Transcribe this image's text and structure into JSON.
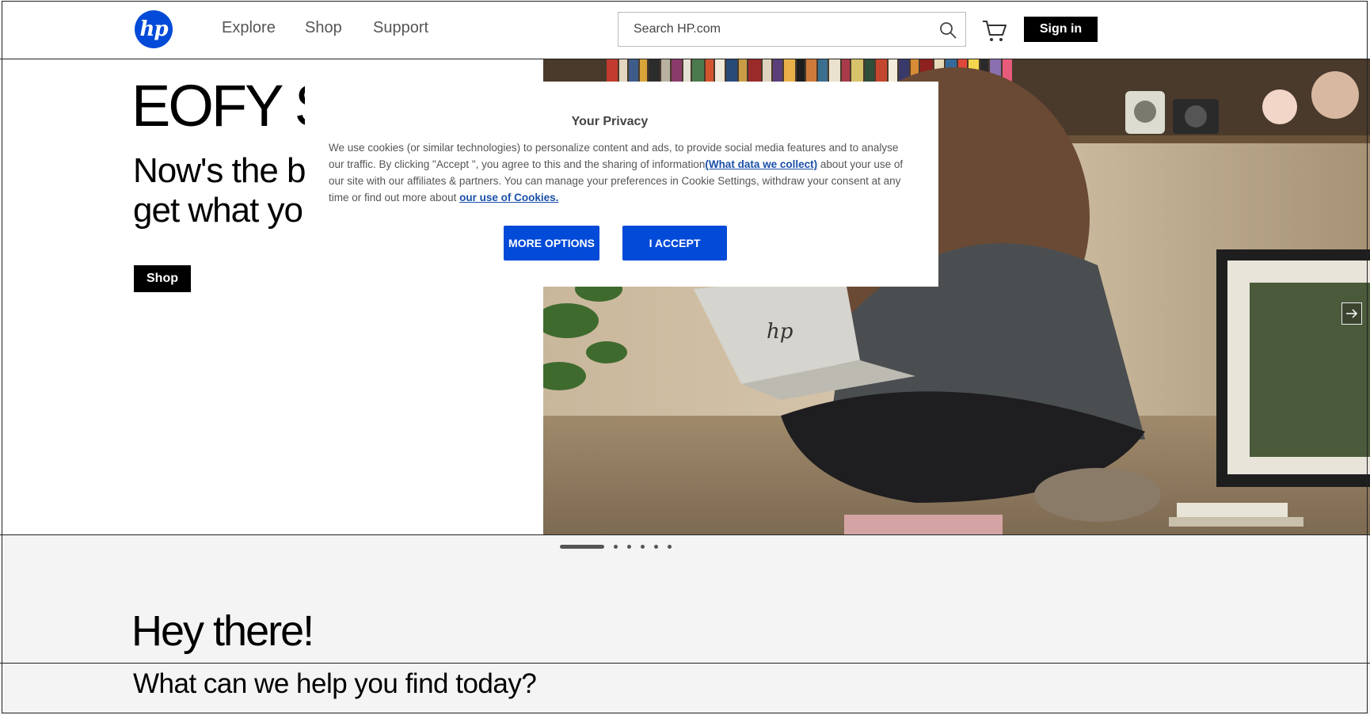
{
  "header": {
    "logo_text": "hp",
    "nav": [
      "Explore",
      "Shop",
      "Support"
    ],
    "search_placeholder": "Search HP.com",
    "sign_in": "Sign in",
    "brand_color": "#024ad8"
  },
  "hero": {
    "title": "EOFY S",
    "subtitle_line1": "Now's the b",
    "subtitle_line2": "get what yo",
    "shop_label": "Shop"
  },
  "cookie": {
    "title": "Your Privacy",
    "text1": "We use cookies (or similar technologies) to personalize content and ads, to provide social media features and to analyse our traffic. By clicking \"Accept \", you agree to this and the sharing of information",
    "link1": "(What data we collect)",
    "text2": " about your use of our site with our affiliates & partners. You can manage your preferences in Cookie Settings, withdraw your consent at any time or find out more about ",
    "link2": "our use of Cookies.",
    "more_options": "MORE OPTIONS",
    "accept": "I ACCEPT"
  },
  "carousel": {
    "slide_count": 6,
    "active_slide": 1
  },
  "lower": {
    "greeting": "Hey there!",
    "question": "What can we help you find today?"
  }
}
